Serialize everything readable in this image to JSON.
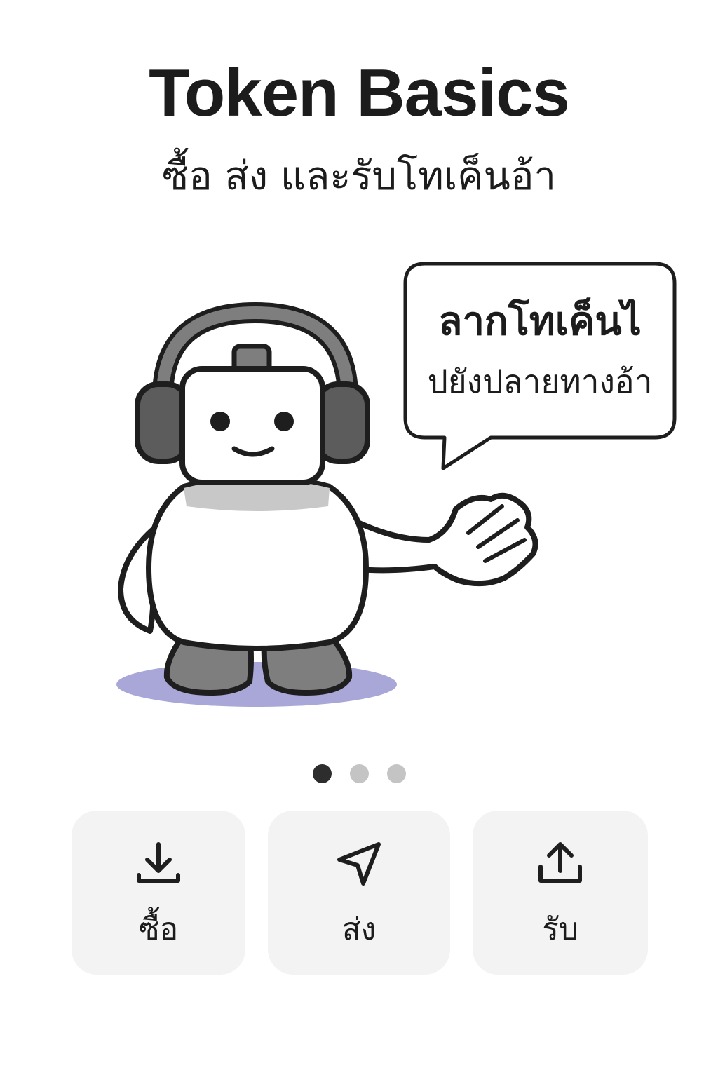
{
  "header": {
    "title": "Token Basics",
    "subtitle": "ซื้อ ส่ง และรับโทเค็นอ้า"
  },
  "speech_bubble": {
    "line1": "ลากโทเค็นไ",
    "line2": "ปยังปลายทางอ้า"
  },
  "pagination": {
    "total": 3,
    "active_index": 0
  },
  "actions": [
    {
      "label": "ซื้อ",
      "icon": "download-icon"
    },
    {
      "label": "ส่ง",
      "icon": "send-icon"
    },
    {
      "label": "รับ",
      "icon": "upload-icon"
    }
  ],
  "colors": {
    "shadow": "#a9a6d8",
    "robot_gray": "#7e7e7e",
    "outline": "#1e1e1e",
    "card_bg": "#f3f3f3",
    "dot_active": "#2d2d2d",
    "dot_inactive": "#c4c4c4"
  }
}
